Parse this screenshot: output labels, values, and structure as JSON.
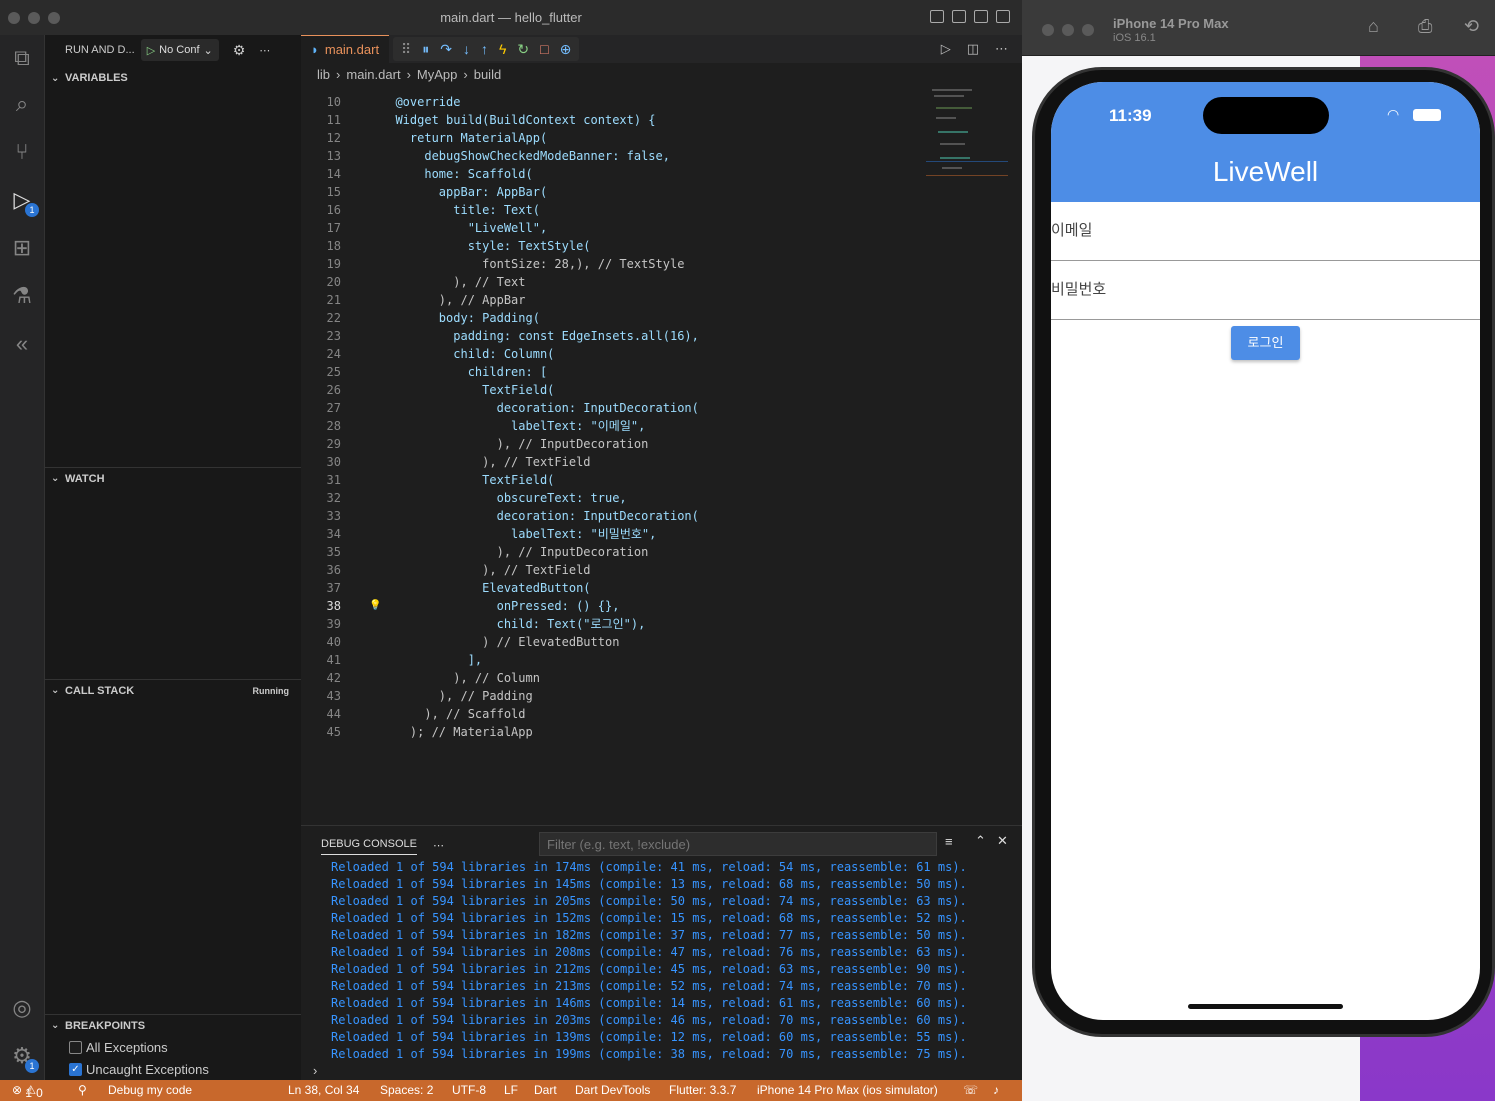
{
  "window": {
    "title": "main.dart — hello_flutter"
  },
  "sidebar": {
    "run_label": "RUN AND D...",
    "config_label": "No Conf",
    "sections": {
      "variables": "VARIABLES",
      "watch": "WATCH",
      "call_stack": "CALL STACK",
      "call_stack_status": "Running",
      "breakpoints": "BREAKPOINTS"
    },
    "breakpoints": [
      {
        "label": "All Exceptions",
        "checked": false
      },
      {
        "label": "Uncaught Exceptions",
        "checked": true
      }
    ],
    "debug_badge": "1",
    "settings_badge": "1"
  },
  "editor": {
    "tab_label": "main.dart",
    "breadcrumbs": [
      "lib",
      "main.dart",
      "MyApp",
      "build"
    ],
    "current_line": "38",
    "lines": [
      {
        "n": "10",
        "t": "  @override"
      },
      {
        "n": "11",
        "t": "  Widget build(BuildContext context) {"
      },
      {
        "n": "12",
        "t": "    return MaterialApp("
      },
      {
        "n": "13",
        "t": "      debugShowCheckedModeBanner: false,"
      },
      {
        "n": "14",
        "t": "      home: Scaffold("
      },
      {
        "n": "15",
        "t": "        appBar: AppBar("
      },
      {
        "n": "16",
        "t": "          title: Text("
      },
      {
        "n": "17",
        "t": "            \"LiveWell\","
      },
      {
        "n": "18",
        "t": "            style: TextStyle("
      },
      {
        "n": "19",
        "t": "              fontSize: 28,), // TextStyle"
      },
      {
        "n": "20",
        "t": "          ), // Text"
      },
      {
        "n": "21",
        "t": "        ), // AppBar"
      },
      {
        "n": "22",
        "t": "        body: Padding("
      },
      {
        "n": "23",
        "t": "          padding: const EdgeInsets.all(16),"
      },
      {
        "n": "24",
        "t": "          child: Column("
      },
      {
        "n": "25",
        "t": "            children: ["
      },
      {
        "n": "26",
        "t": "              TextField("
      },
      {
        "n": "27",
        "t": "                decoration: InputDecoration("
      },
      {
        "n": "28",
        "t": "                  labelText: \"이메일\","
      },
      {
        "n": "29",
        "t": "                ), // InputDecoration"
      },
      {
        "n": "30",
        "t": "              ), // TextField"
      },
      {
        "n": "31",
        "t": "              TextField("
      },
      {
        "n": "32",
        "t": "                obscureText: true,"
      },
      {
        "n": "33",
        "t": "                decoration: InputDecoration("
      },
      {
        "n": "34",
        "t": "                  labelText: \"비밀번호\","
      },
      {
        "n": "35",
        "t": "                ), // InputDecoration"
      },
      {
        "n": "36",
        "t": "              ), // TextField"
      },
      {
        "n": "37",
        "t": "              ElevatedButton("
      },
      {
        "n": "38",
        "t": "                onPressed: () {},"
      },
      {
        "n": "39",
        "t": "                child: Text(\"로그인\"),"
      },
      {
        "n": "40",
        "t": "              ) // ElevatedButton"
      },
      {
        "n": "41",
        "t": "            ],"
      },
      {
        "n": "42",
        "t": "          ), // Column"
      },
      {
        "n": "43",
        "t": "        ), // Padding"
      },
      {
        "n": "44",
        "t": "      ), // Scaffold"
      },
      {
        "n": "45",
        "t": "    ); // MaterialApp"
      }
    ]
  },
  "panel": {
    "tab_label": "DEBUG CONSOLE",
    "filter_placeholder": "Filter (e.g. text, !exclude)",
    "lines": [
      "Reloaded 1 of 594 libraries in 174ms (compile: 41 ms, reload: 54 ms, reassemble: 61 ms).",
      "Reloaded 1 of 594 libraries in 145ms (compile: 13 ms, reload: 68 ms, reassemble: 50 ms).",
      "Reloaded 1 of 594 libraries in 205ms (compile: 50 ms, reload: 74 ms, reassemble: 63 ms).",
      "Reloaded 1 of 594 libraries in 152ms (compile: 15 ms, reload: 68 ms, reassemble: 52 ms).",
      "Reloaded 1 of 594 libraries in 182ms (compile: 37 ms, reload: 77 ms, reassemble: 50 ms).",
      "Reloaded 1 of 594 libraries in 208ms (compile: 47 ms, reload: 76 ms, reassemble: 63 ms).",
      "Reloaded 1 of 594 libraries in 212ms (compile: 45 ms, reload: 63 ms, reassemble: 90 ms).",
      "Reloaded 1 of 594 libraries in 213ms (compile: 52 ms, reload: 74 ms, reassemble: 70 ms).",
      "Reloaded 1 of 594 libraries in 146ms (compile: 14 ms, reload: 61 ms, reassemble: 60 ms).",
      "Reloaded 1 of 594 libraries in 203ms (compile: 46 ms, reload: 70 ms, reassemble: 60 ms).",
      "Reloaded 1 of 594 libraries in 139ms (compile: 12 ms, reload: 60 ms, reassemble: 55 ms).",
      "Reloaded 1 of 594 libraries in 199ms (compile: 38 ms, reload: 70 ms, reassemble: 75 ms)."
    ]
  },
  "statusbar": {
    "errors": "1",
    "warnings": "0",
    "debug_label": "Debug my code",
    "position": "Ln 38, Col 34",
    "spaces": "Spaces: 2",
    "encoding": "UTF-8",
    "eol": "LF",
    "language": "Dart",
    "devtools": "Dart DevTools",
    "flutter": "Flutter: 3.3.7",
    "device": "iPhone 14 Pro Max (ios simulator)",
    "color": "#c8682c"
  },
  "simulator": {
    "device_name": "iPhone 14 Pro Max",
    "os": "iOS 16.1",
    "time": "11:39",
    "app_title": "LiveWell",
    "email_label": "이메일",
    "password_label": "비밀번호",
    "login_label": "로그인",
    "accent": "#4d8de6"
  }
}
